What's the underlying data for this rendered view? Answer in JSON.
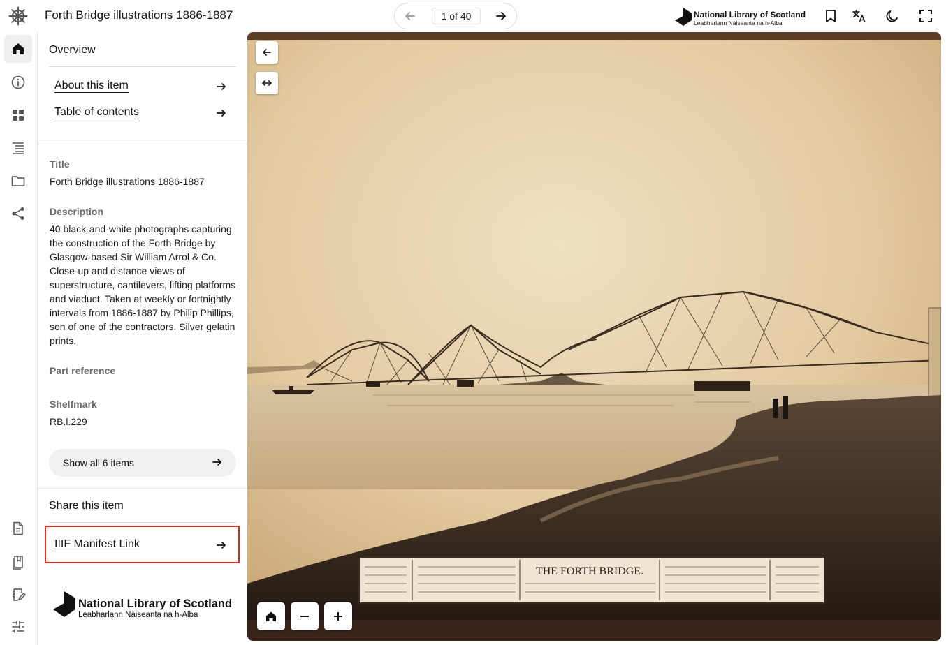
{
  "header": {
    "title": "Forth Bridge illustrations 1886-1887",
    "pager": {
      "counter": "1 of 40"
    },
    "logo": {
      "name": "National Library of Scotland",
      "gaelic": "Leabharlann Nàiseanta na h-Alba"
    }
  },
  "rail": {
    "items": [
      "home-icon",
      "info-icon",
      "grid-icon",
      "contents-icon",
      "folder-icon",
      "share-icon",
      "document-icon",
      "bookmarks-icon",
      "notes-icon",
      "settings-icon"
    ]
  },
  "panel": {
    "overview_heading": "Overview",
    "links": [
      {
        "label": "About this item"
      },
      {
        "label": "Table of contents"
      }
    ],
    "metadata": {
      "title_label": "Title",
      "title_value": "Forth Bridge illustrations 1886-1887",
      "description_label": "Description",
      "description_value": "40 black-and-white photographs capturing the construction of the Forth Bridge by Glasgow-based Sir William Arrol & Co. Close-up and distance views of superstructure, cantilevers, lifting platforms and viaduct. Taken at weekly or fortnightly intervals from 1886-1887 by Philip Phillips, son of one of the contractors. Silver gelatin prints.",
      "part_reference_label": "Part reference",
      "shelfmark_label": "Shelfmark",
      "shelfmark_value": "RB.l.229"
    },
    "show_all": "Show all 6 items",
    "share_heading": "Share this item",
    "share_link": "IIIF Manifest Link",
    "footer_logo": {
      "name": "National Library of Scotland",
      "gaelic": "Leabharlann Nàiseanta na h-Alba"
    }
  },
  "viewer": {
    "plaque_title": "THE FORTH BRIDGE.",
    "controls": [
      "back-icon",
      "fit-width-icon",
      "home-icon",
      "zoom-out-icon",
      "zoom-in-icon"
    ]
  },
  "colors": {
    "highlight": "#e12a1f",
    "sepia": "#d9c29a"
  }
}
